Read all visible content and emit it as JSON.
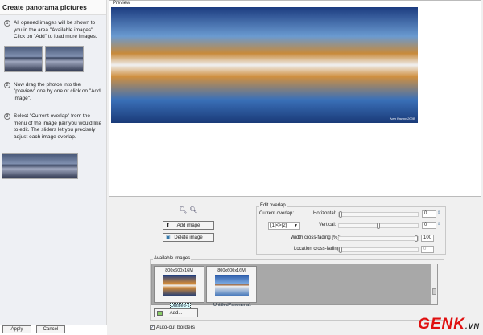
{
  "left": {
    "title": "Create panorama pictures",
    "steps": [
      {
        "n": "1",
        "text": "All opened images will be shown to you in the area \"Available images\". Click on \"Add\" to load more images."
      },
      {
        "n": "2",
        "text": "Now drag the photos into the \"preview\" one by one or click on \"Add image\"."
      },
      {
        "n": "3",
        "text": "Select \"Current overlap\" from the menu of the image pair you would like to edit. The sliders let you precisely adjust each image overlap."
      }
    ],
    "apply": "Apply",
    "cancel": "Cancel"
  },
  "preview": {
    "label": "Preview",
    "watermark": "Ivan Pavlov 2008"
  },
  "tools": {
    "add_image": "Add image",
    "delete_image": "Delete image"
  },
  "overlap": {
    "label": "Edit overlap",
    "current_label": "Current overlap:",
    "current_value": "[1]<>[2]",
    "horizontal_label": "Horizontal:",
    "horizontal": "0",
    "horizontal_pct": 0,
    "vertical_label": "Vertical:",
    "vertical": "0",
    "vertical_pct": 50,
    "width_label": "Width cross-fading [%]:",
    "width": "100",
    "width_pct": 100,
    "location_label": "Location cross-fading:",
    "location": "0",
    "location_pct": 0
  },
  "available": {
    "label": "Available images",
    "items": [
      {
        "size": "800x600x16M",
        "name": "Untitled-1"
      },
      {
        "size": "800x600x16M",
        "name": "UntitledPanorama1"
      }
    ],
    "add": "Add..."
  },
  "autocut": {
    "label": "Auto-cut borders",
    "checked": true
  },
  "logo": {
    "main": "GENK",
    "suffix": ".VN"
  }
}
